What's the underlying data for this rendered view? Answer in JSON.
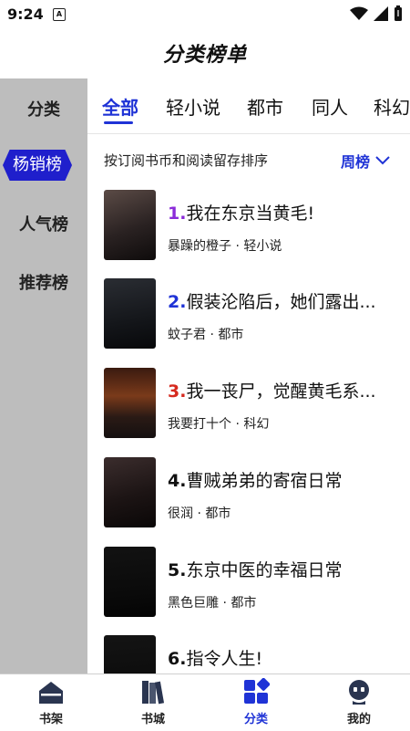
{
  "status_bar": {
    "time": "9:24",
    "notification_badge": "A"
  },
  "header": {
    "title": "分类榜单"
  },
  "sidebar": {
    "heading": "分类",
    "items": [
      {
        "label": "杨销榜",
        "active": true
      },
      {
        "label": "人气榜",
        "active": false
      },
      {
        "label": "推荐榜",
        "active": false
      }
    ]
  },
  "tabs": [
    {
      "label": "全部",
      "active": true
    },
    {
      "label": "轻小说",
      "active": false
    },
    {
      "label": "都市",
      "active": false
    },
    {
      "label": "同人",
      "active": false
    },
    {
      "label": "科幻",
      "active": false
    }
  ],
  "sort": {
    "description": "按订阅书币和阅读留存排序",
    "period": "周榜"
  },
  "books": [
    {
      "rank": "1.",
      "title": "我在东京当黄毛!",
      "author": "暴躁的橙子",
      "genre": "轻小说",
      "rank_color": "#8b2bd9"
    },
    {
      "rank": "2.",
      "title": "假装沦陷后，她们露出...",
      "author": "蚊子君",
      "genre": "都市",
      "rank_color": "#1f33d6"
    },
    {
      "rank": "3.",
      "title": "我一丧尸，觉醒黄毛系...",
      "author": "我要打十个",
      "genre": "科幻",
      "rank_color": "#d62a1f"
    },
    {
      "rank": "4.",
      "title": "曹贼弟弟的寄宿日常",
      "author": "很润",
      "genre": "都市",
      "rank_color": "#111111"
    },
    {
      "rank": "5.",
      "title": "东京中医的幸福日常",
      "author": "黑色巨雕",
      "genre": "都市",
      "rank_color": "#111111"
    },
    {
      "rank": "6.",
      "title": "指令人生!",
      "author": "",
      "genre": "",
      "rank_color": "#111111"
    }
  ],
  "bottom_nav": [
    {
      "label": "书架",
      "icon": "bookshelf-icon",
      "active": false
    },
    {
      "label": "书城",
      "icon": "bookstore-icon",
      "active": false
    },
    {
      "label": "分类",
      "icon": "category-icon",
      "active": true
    },
    {
      "label": "我的",
      "icon": "profile-icon",
      "active": false
    }
  ],
  "colors": {
    "accent": "#1f33d6",
    "sidebar_bg": "#bdbdbd"
  }
}
